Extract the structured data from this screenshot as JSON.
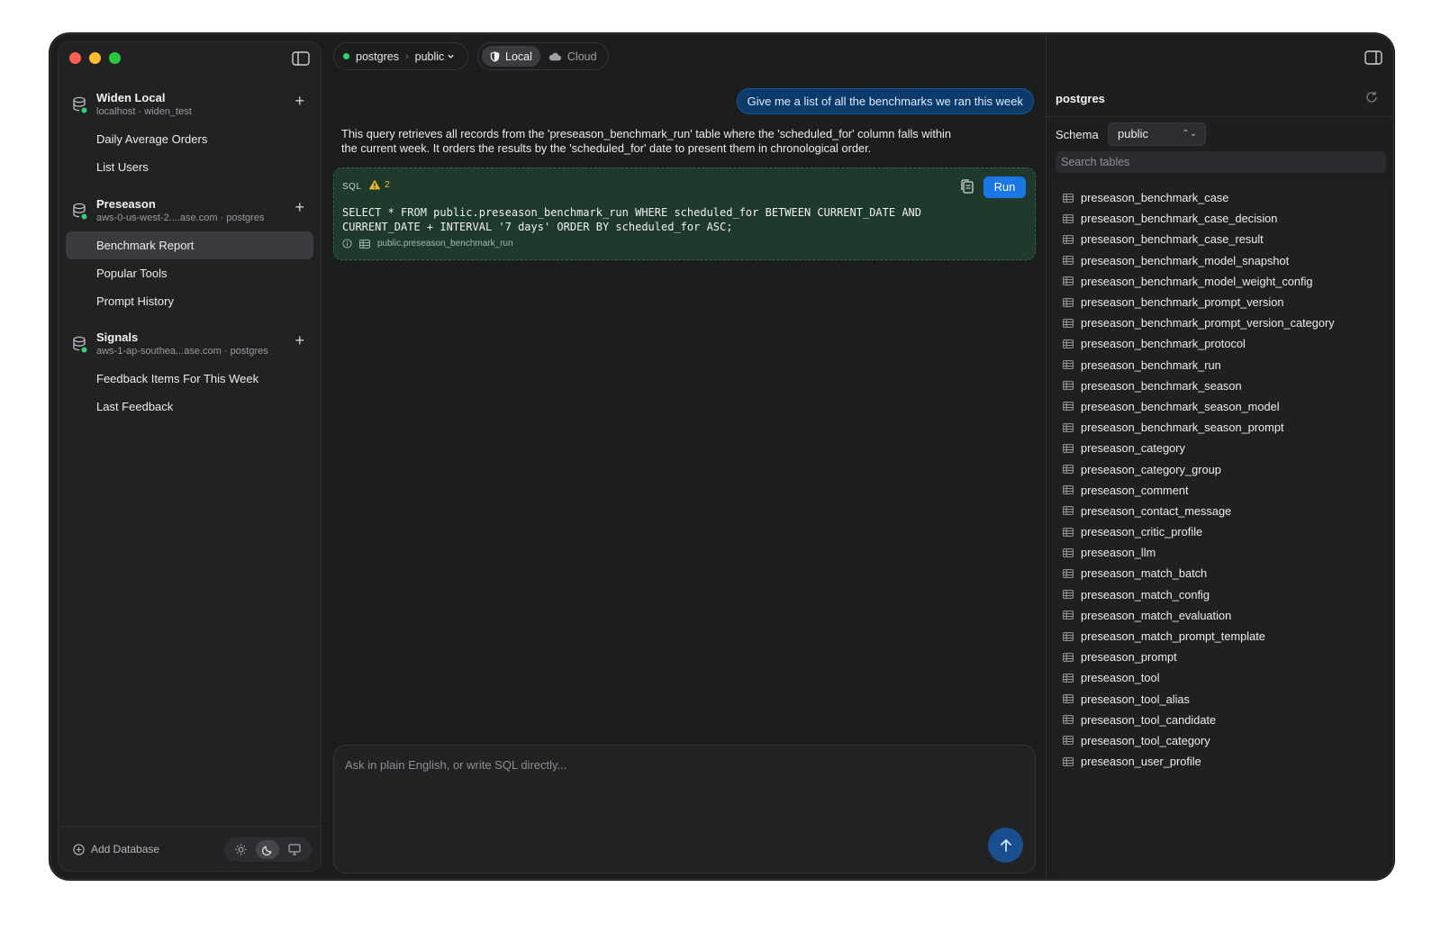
{
  "sidebar": {
    "databases": [
      {
        "name": "Widen Local",
        "subtitle": "localhost · widen_test",
        "add_label": "+",
        "queries": [
          {
            "label": "Daily Average Orders",
            "active": false
          },
          {
            "label": "List Users",
            "active": false
          }
        ]
      },
      {
        "name": "Preseason",
        "subtitle": "aws-0-us-west-2....ase.com · postgres",
        "add_label": "+",
        "queries": [
          {
            "label": "Benchmark Report",
            "active": true
          },
          {
            "label": "Popular Tools",
            "active": false
          },
          {
            "label": "Prompt History",
            "active": false
          }
        ]
      },
      {
        "name": "Signals",
        "subtitle": "aws-1-ap-southea...ase.com · postgres",
        "add_label": "+",
        "queries": [
          {
            "label": "Feedback Items For This Week",
            "active": false
          },
          {
            "label": "Last Feedback",
            "active": false
          }
        ]
      }
    ],
    "footer": {
      "add_database": "Add Database",
      "theme_active": "dark"
    }
  },
  "topbar": {
    "connection": "postgres",
    "schema": "public",
    "env": {
      "local": "Local",
      "cloud": "Cloud",
      "active": "local"
    }
  },
  "chat": {
    "user_message": "Give me a list of all the benchmarks we ran this week",
    "assistant_text": "This query retrieves all records from the 'preseason_benchmark_run' table where the 'scheduled_for' column falls within the current week. It orders the results by the 'scheduled_for' date to present them in chronological order.",
    "sql_card": {
      "tag": "SQL",
      "warning_count": "2",
      "run_label": "Run",
      "code": "SELECT * FROM public.preseason_benchmark_run WHERE scheduled_for BETWEEN CURRENT_DATE AND CURRENT_DATE + INTERVAL '7 days' ORDER BY scheduled_for ASC;",
      "table_ref": "public.preseason_benchmark_run"
    }
  },
  "composer": {
    "placeholder": "Ask in plain English, or write SQL directly..."
  },
  "right_panel": {
    "title": "postgres",
    "schema_label": "Schema",
    "schema_value": "public",
    "search_placeholder": "Search tables",
    "tables": [
      "preseason_benchmark_case",
      "preseason_benchmark_case_decision",
      "preseason_benchmark_case_result",
      "preseason_benchmark_model_snapshot",
      "preseason_benchmark_model_weight_config",
      "preseason_benchmark_prompt_version",
      "preseason_benchmark_prompt_version_category",
      "preseason_benchmark_protocol",
      "preseason_benchmark_run",
      "preseason_benchmark_season",
      "preseason_benchmark_season_model",
      "preseason_benchmark_season_prompt",
      "preseason_category",
      "preseason_category_group",
      "preseason_comment",
      "preseason_contact_message",
      "preseason_critic_profile",
      "preseason_llm",
      "preseason_match_batch",
      "preseason_match_config",
      "preseason_match_evaluation",
      "preseason_match_prompt_template",
      "preseason_prompt",
      "preseason_tool",
      "preseason_tool_alias",
      "preseason_tool_candidate",
      "preseason_tool_category",
      "preseason_user_profile"
    ]
  },
  "colors": {
    "accent": "#1978e6",
    "status_green": "#2fd36b",
    "warning": "#f0b429",
    "sql_card_bg": "#1f3a2d"
  }
}
